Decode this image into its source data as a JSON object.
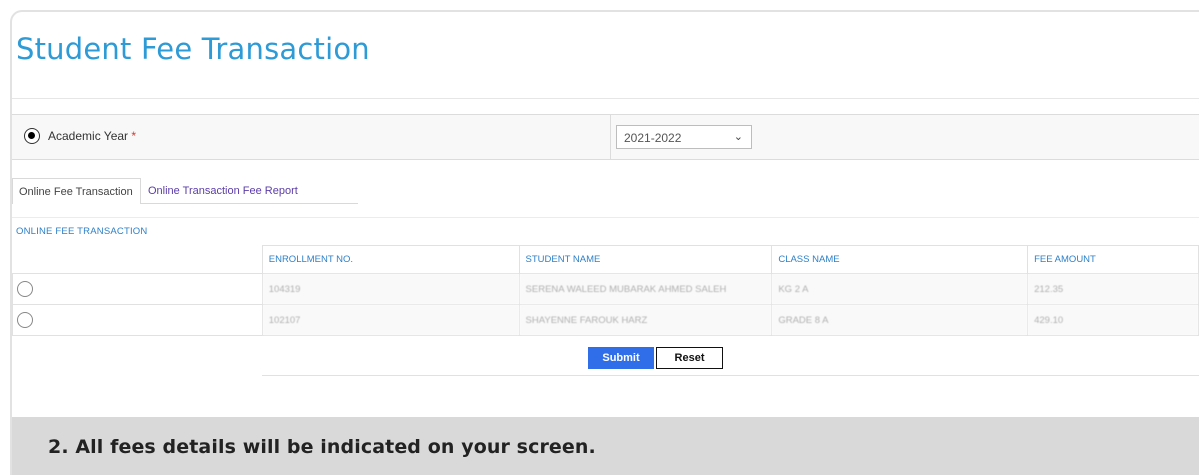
{
  "page": {
    "title": "Student Fee Transaction"
  },
  "academic_year": {
    "label": "Academic Year",
    "required_mark": "*",
    "selected_value": "2021-2022"
  },
  "tabs": [
    {
      "label": "Online Fee Transaction",
      "active": true
    },
    {
      "label": "Online Transaction Fee Report",
      "active": false
    }
  ],
  "section": {
    "label": "ONLINE FEE TRANSACTION"
  },
  "table": {
    "headers": [
      "ENROLLMENT NO.",
      "STUDENT NAME",
      "CLASS NAME",
      "FEE AMOUNT"
    ],
    "rows": [
      {
        "enrollment_no": "104319",
        "student_name": "SERENA WALEED MUBARAK AHMED SALEH",
        "class_name": "KG 2 A",
        "fee_amount": "212.35"
      },
      {
        "enrollment_no": "102107",
        "student_name": "SHAYENNE FAROUK HARZ",
        "class_name": "GRADE 8 A",
        "fee_amount": "429.10"
      }
    ]
  },
  "buttons": {
    "submit": "Submit",
    "reset": "Reset"
  },
  "caption": "2. All fees details will be indicated on your screen.",
  "colors": {
    "title": "#2e9bd6",
    "link": "#2e80c8",
    "tab_inactive": "#5b3da8",
    "submit_bg": "#2f6ee8",
    "required": "#e0322a",
    "caption_band": "#d9d9d9"
  },
  "icons": {
    "select_chevron": "chevron-down-icon",
    "year_radio": "radio-selected-icon",
    "row_radio": "radio-unselected-icon"
  }
}
